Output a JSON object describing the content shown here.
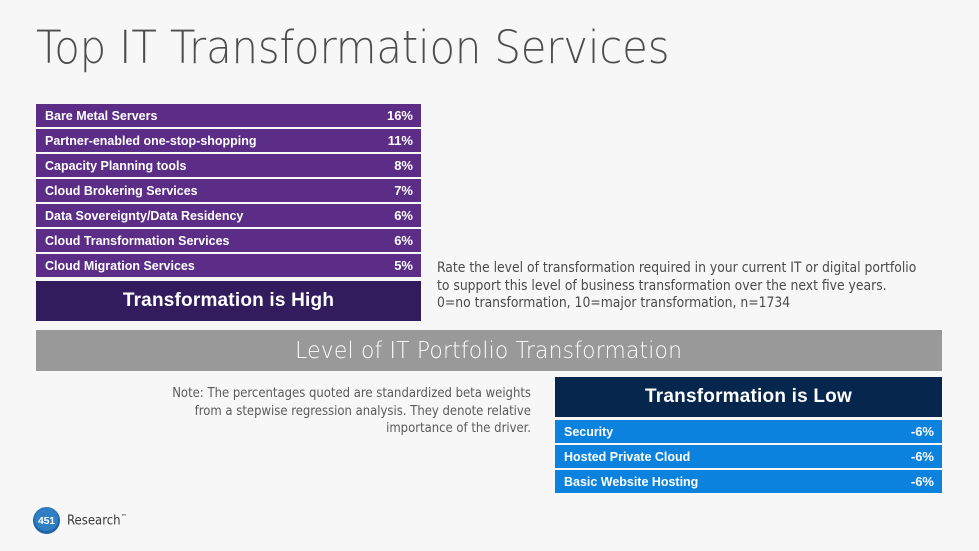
{
  "slide": {
    "title": "Top IT Transformation Services",
    "background_color": "#f7f7f7"
  },
  "high_table": {
    "accent_color": "#5b2d87",
    "header_color": "#331c5e",
    "footer_label": "Transformation is High",
    "rows": [
      {
        "label": "Bare Metal Servers",
        "value": "16%"
      },
      {
        "label": "Partner-enabled one-stop-shopping",
        "value": "11%"
      },
      {
        "label": "Capacity Planning tools",
        "value": "8%"
      },
      {
        "label": "Cloud Brokering Services",
        "value": "7%"
      },
      {
        "label": "Data Sovereignty/Data Residency",
        "value": "6%"
      },
      {
        "label": "Cloud Transformation Services",
        "value": "6%"
      },
      {
        "label": "Cloud Migration Services",
        "value": "5%"
      }
    ]
  },
  "question": {
    "text": "Rate the level of transformation required in your current IT or digital portfolio to support this level of business transformation over the next five years. 0=no transformation, 10=major transformation, n=1734"
  },
  "gray_band": {
    "label": "Level of IT Portfolio Transformation",
    "color": "#999999"
  },
  "note": {
    "text": "Note: The percentages quoted are standardized beta weights from a stepwise regression analysis. They denote relative importance of the driver."
  },
  "low_table": {
    "accent_color": "#0b82de",
    "header_color": "#06264e",
    "header_label": "Transformation is Low",
    "rows": [
      {
        "label": "Security",
        "value": "-6%"
      },
      {
        "label": "Hosted Private Cloud",
        "value": "-6%"
      },
      {
        "label": "Basic Website Hosting",
        "value": "-6%"
      }
    ]
  },
  "logo": {
    "mark": "451",
    "word": "Research",
    "trademark": "™",
    "color": "#2f7fc4"
  },
  "chart_data": {
    "type": "table",
    "title": "Top IT Transformation Services",
    "subtitle": "Level of IT Portfolio Transformation",
    "series": [
      {
        "name": "Transformation is High",
        "categories": [
          "Bare Metal Servers",
          "Partner-enabled one-stop-shopping",
          "Capacity Planning tools",
          "Cloud Brokering Services",
          "Data Sovereignty/Data Residency",
          "Cloud Transformation Services",
          "Cloud Migration Services"
        ],
        "values": [
          16,
          11,
          8,
          7,
          6,
          6,
          5
        ],
        "unit": "%"
      },
      {
        "name": "Transformation is Low",
        "categories": [
          "Security",
          "Hosted Private Cloud",
          "Basic Website Hosting"
        ],
        "values": [
          -6,
          -6,
          -6
        ],
        "unit": "%"
      }
    ],
    "annotations": [
      "Note: The percentages quoted are standardized beta weights from a stepwise regression analysis. They denote relative importance of the driver.",
      "Rate the level of transformation required in your current IT or digital portfolio to support this level of business transformation over the next five years. 0=no transformation, 10=major transformation, n=1734"
    ],
    "sample_size": 1734
  }
}
